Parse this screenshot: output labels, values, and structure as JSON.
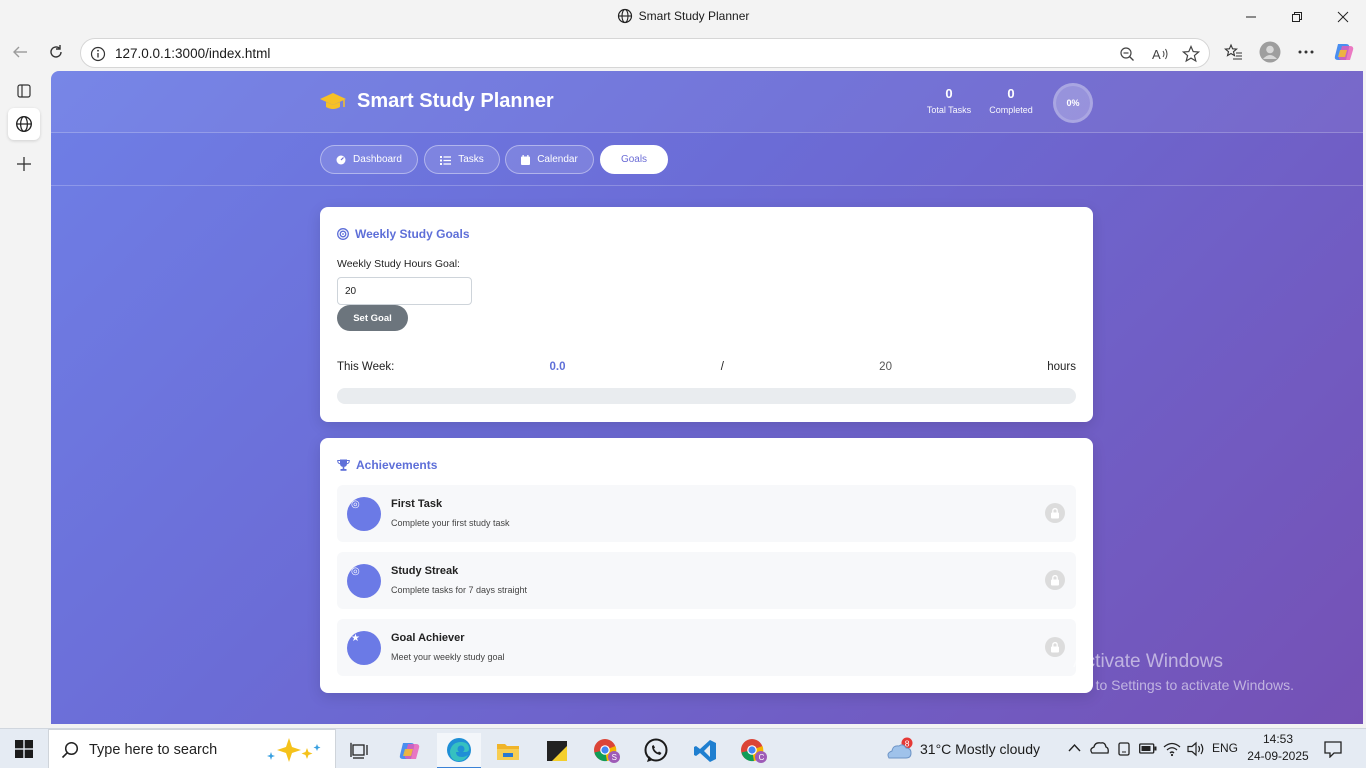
{
  "browser": {
    "window_title": "Smart Study Planner",
    "url": "127.0.0.1:3000/index.html"
  },
  "app": {
    "title": "Smart Study Planner",
    "stats": {
      "total_tasks_value": "0",
      "total_tasks_label": "Total Tasks",
      "completed_value": "0",
      "completed_label": "Completed",
      "progress_label": "0%"
    },
    "nav_tabs": [
      {
        "label": "Dashboard",
        "icon": "gauge-icon",
        "active": false
      },
      {
        "label": "Tasks",
        "icon": "list-icon",
        "active": false
      },
      {
        "label": "Calendar",
        "icon": "calendar-icon",
        "active": false
      },
      {
        "label": "Goals",
        "icon": "target-icon",
        "active": true
      }
    ]
  },
  "goals": {
    "title": "Weekly Study Goals",
    "hours_goal_label": "Weekly Study Hours Goal:",
    "hours_goal_value": "20",
    "set_goal_button": "Set Goal",
    "this_week_label": "This Week:",
    "hours_done": "0.0",
    "separator": "/",
    "hours_target": "20",
    "unit": "hours",
    "progress_fraction": 0
  },
  "achievements": {
    "title": "Achievements",
    "items": [
      {
        "name": "First Task",
        "description": "Complete your first study task",
        "locked": true
      },
      {
        "name": "Study Streak",
        "description": "Complete tasks for 7 days straight",
        "locked": true
      },
      {
        "name": "Goal Achiever",
        "description": "Meet your weekly study goal",
        "locked": true
      }
    ]
  },
  "watermark": {
    "line1": "Activate Windows",
    "line2": "Go to Settings to activate Windows."
  },
  "taskbar": {
    "search_placeholder": "Type here to search",
    "weather_badge": "8",
    "weather": "31°C  Mostly cloudy",
    "language": "ENG",
    "time": "14:53",
    "date": "24-09-2025"
  },
  "colors": {
    "accent": "#6b6cd6",
    "gradient_start": "#6f7fe6",
    "gradient_end": "#7551b5"
  }
}
